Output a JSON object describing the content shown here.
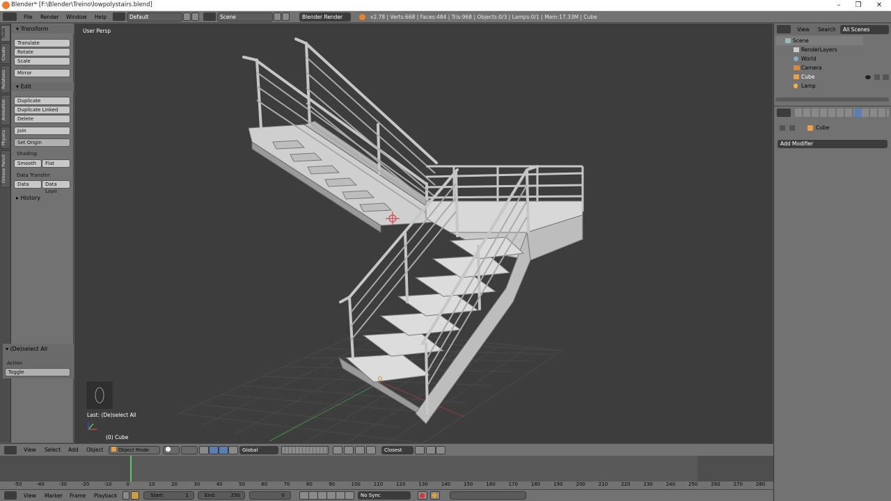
{
  "window": {
    "title": "Blender* [F:\\Blender\\Treino\\lowpolystairs.blend]",
    "minimize": "–",
    "maximize": "❐",
    "close": "✕"
  },
  "info_bar": {
    "menus": [
      "File",
      "Render",
      "Window",
      "Help"
    ],
    "layout": "Default",
    "scene": "Scene",
    "engine": "Blender Render",
    "stats": "v2.78 | Verts:668 | Faces:484 | Tris:968 | Objects:0/3 | Lamps:0/1 | Mem:17.33M | Cube"
  },
  "left_tabs": [
    "Tools",
    "Create",
    "Relations",
    "Animation",
    "Physics",
    "Grease Pencil"
  ],
  "tool_shelf": {
    "transform_header": "Transform",
    "transform_buttons": [
      "Translate",
      "Rotate",
      "Scale"
    ],
    "mirror": "Mirror",
    "edit_header": "Edit",
    "edit_buttons": [
      "Duplicate",
      "Duplicate Linked",
      "Delete"
    ],
    "join": "Join",
    "set_origin": "Set Origin",
    "shading_label": "Shading:",
    "smooth": "Smooth",
    "flat": "Flat",
    "data_transfer_label": "Data Transfer:",
    "data": "Data",
    "data_layout": "Data Layo",
    "history_header": "History"
  },
  "operator_panel": {
    "header": "(De)select All",
    "action_label": "Action",
    "action_value": "Toggle"
  },
  "viewport": {
    "view_name": "User Persp",
    "last_op": "Last: (De)select All",
    "object_label": "(0) Cube"
  },
  "outliner": {
    "tabs": [
      "View",
      "Search",
      "All Scenes"
    ],
    "items": [
      {
        "label": "Scene",
        "icon": "scene-icon"
      },
      {
        "label": "RenderLayers",
        "icon": "render-layers-icon"
      },
      {
        "label": "World",
        "icon": "world-icon"
      },
      {
        "label": "Camera",
        "icon": "camera-icon"
      },
      {
        "label": "Cube",
        "icon": "mesh-icon"
      },
      {
        "label": "Lamp",
        "icon": "lamp-icon"
      }
    ]
  },
  "properties": {
    "object_name": "Cube",
    "add_modifier": "Add Modifier"
  },
  "viewport_header": {
    "menus": [
      "View",
      "Select",
      "Add",
      "Object"
    ],
    "mode": "Object Mode",
    "orientation": "Global",
    "snap": "Closest"
  },
  "timeline": {
    "ticks": [
      "-50",
      "-40",
      "-30",
      "-20",
      "-10",
      "0",
      "10",
      "20",
      "30",
      "40",
      "50",
      "60",
      "70",
      "80",
      "90",
      "100",
      "110",
      "120",
      "130",
      "140",
      "150",
      "160",
      "170",
      "180",
      "190",
      "200",
      "210",
      "220",
      "230",
      "240",
      "250",
      "260",
      "270",
      "280"
    ],
    "current_frame_marker": 0
  },
  "timeline_header": {
    "menus": [
      "View",
      "Marker",
      "Frame",
      "Playback"
    ],
    "start_label": "Start:",
    "start_value": "1",
    "end_label": "End:",
    "end_value": "250",
    "current": "0",
    "sync": "No Sync"
  }
}
